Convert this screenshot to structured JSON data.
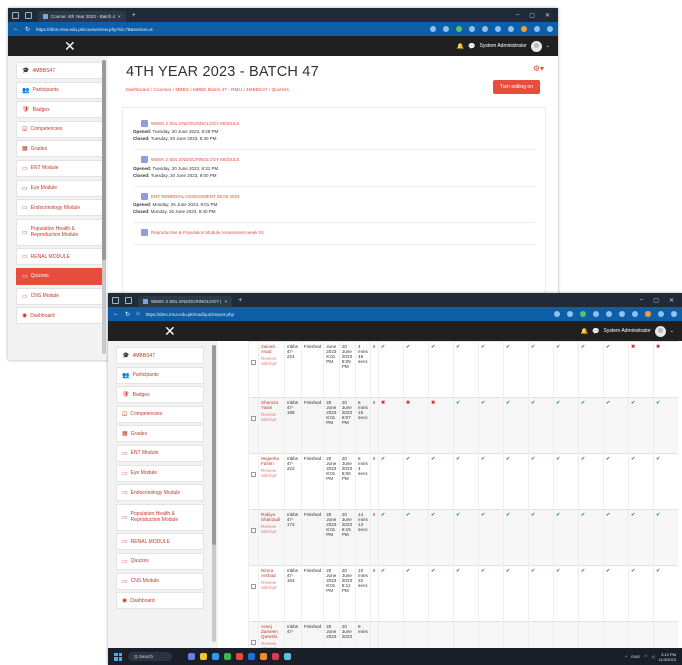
{
  "win1": {
    "tab_title": "Course: 4th Year 2023 - Batch 4",
    "url": "https://dms.rmur.edu.pk/course/view.php?id=75&section=6",
    "user": "System Administrator",
    "page_title": "4TH YEAR 2023 - BATCH 47",
    "breadcrumb": "Dashboard  /  Courses  /  MBBS  /  MBBS Batch 47 - RMU  /  4MBBS47  /  Quizzes",
    "edit_button": "Turn editing on",
    "nav": [
      {
        "label": "4MBBS47",
        "icon": "graduation-cap-icon",
        "glyph": "🎓"
      },
      {
        "label": "Participants",
        "icon": "users-icon",
        "glyph": "👥"
      },
      {
        "label": "Badges",
        "icon": "shield-icon",
        "glyph": "🛡"
      },
      {
        "label": "Competencies",
        "icon": "check-square-icon",
        "glyph": "☑"
      },
      {
        "label": "Grades",
        "icon": "table-icon",
        "glyph": "▦"
      },
      {
        "label": "ENT Module",
        "icon": "folder-icon",
        "glyph": "▭"
      },
      {
        "label": "Eye Module",
        "icon": "folder-icon",
        "glyph": "▭"
      },
      {
        "label": "Endocrinology Module",
        "icon": "folder-icon",
        "glyph": "▭"
      },
      {
        "label": "Population Health & Reproduction Module",
        "icon": "folder-icon",
        "glyph": "▭"
      },
      {
        "label": "RENAL MODULE",
        "icon": "folder-icon",
        "glyph": "▭"
      },
      {
        "label": "Quizzes",
        "icon": "folder-icon",
        "glyph": "▭"
      },
      {
        "label": "CNS Module",
        "icon": "folder-icon",
        "glyph": "▭"
      },
      {
        "label": "Dashboard",
        "icon": "tachometer-icon",
        "glyph": "◉"
      }
    ],
    "quizzes": [
      {
        "title": "WEEK 2 SDL ENDOCRINOLOGY MODULE",
        "opened": "Tuesday, 20 June 2023, 8:28 PM",
        "closed": "Tuesday, 20 June 2023, 8:30 PM"
      },
      {
        "title": "WEEK 2 SDL ENDOCRINOLOGY MODULE",
        "opened": "Tuesday, 20 June 2023, 8:31 PM",
        "closed": "Tuesday, 20 June 2023, 9:00 PM"
      },
      {
        "title": "ENT REMEDIAL ASSESSMENT 26.06.2023",
        "opened": "Monday, 26 June 2023, 9:01 PM",
        "closed": "Monday, 26 June 2023, 9:40 PM"
      },
      {
        "title": "Reproductive & Population Module Assessment week 01",
        "opened": "",
        "closed": ""
      }
    ],
    "labels": {
      "opened": "Opened:",
      "closed": "Closed:"
    }
  },
  "win2": {
    "tab_title": "WEEK 2 SDL ENDOCRINOLOGY |",
    "url": "https://dms.rmur.edu.pk/mod/quiz/report.php",
    "user": "System Administrator",
    "nav": [
      {
        "label": "4MBBS47",
        "glyph": "🎓"
      },
      {
        "label": "Participants",
        "glyph": "👥"
      },
      {
        "label": "Badges",
        "glyph": "🛡"
      },
      {
        "label": "Competencies",
        "glyph": "☑"
      },
      {
        "label": "Grades",
        "glyph": "▦"
      },
      {
        "label": "ENT Module",
        "glyph": "▭"
      },
      {
        "label": "Eye Module",
        "glyph": "▭"
      },
      {
        "label": "Endocrinology Module",
        "glyph": "▭"
      },
      {
        "label": "Population Health & Reproduction Module",
        "glyph": "▭"
      },
      {
        "label": "RENAL MODULE",
        "glyph": "▭"
      },
      {
        "label": "Quizzes",
        "glyph": "▭"
      },
      {
        "label": "CNS Module",
        "glyph": "▭"
      },
      {
        "label": "Dashboard",
        "glyph": "◉"
      }
    ],
    "review_label": "Review attempt",
    "rows": [
      {
        "name": "Zainab Asad",
        "id": "mbbs 47-224",
        "state": "Finished",
        "started": "June 2023 8:01 PM",
        "completed": "20 June 2023 8:05 PM",
        "taken": "4 mins 46 secs",
        "grade": "8",
        "marks": [
          "ok",
          "ok",
          "ok",
          "ok",
          "ok",
          "ok",
          "ok",
          "ok",
          "ok",
          "ok",
          "bad",
          "bad"
        ]
      },
      {
        "name": "Sharoza Yasin",
        "id": "mbbs 47-198",
        "state": "Finished",
        "started": "20 June 2023 8:01 PM",
        "completed": "20 June 2023 8:07 PM",
        "taken": "6 mins 15 secs",
        "grade": "6",
        "marks": [
          "bad",
          "bad",
          "bad",
          "ok",
          "ok",
          "ok",
          "ok",
          "ok",
          "ok",
          "ok",
          "ok",
          "ok"
        ]
      },
      {
        "name": "Wajeeha Fahim",
        "id": "mbbs 47-222",
        "state": "Finished",
        "started": "20 June 2023 8:01 PM",
        "completed": "20 June 2023 8:06 PM",
        "taken": "5 mins 4 secs",
        "grade": "9",
        "marks": [
          "ok",
          "ok",
          "ok",
          "ok",
          "ok",
          "ok",
          "ok",
          "ok",
          "ok",
          "ok",
          "ok",
          "ok"
        ]
      },
      {
        "name": "Rabiya Shahzadi",
        "id": "mbbs 47-173",
        "state": "Finished",
        "started": "20 June 2023 8:01 PM",
        "completed": "20 June 2023 8:15 PM",
        "taken": "14 mins 13 secs",
        "grade": "8",
        "marks": [
          "ok",
          "ok",
          "ok",
          "ok",
          "ok",
          "ok",
          "ok",
          "ok",
          "ok",
          "ok",
          "ok",
          "ok"
        ]
      },
      {
        "name": "Nimra Arshad",
        "id": "mbbs 47-163",
        "state": "Finished",
        "started": "20 June 2023 8:01 PM",
        "completed": "20 June 2023 8:11 PM",
        "taken": "10 mins 32 secs",
        "grade": "8",
        "marks": [
          "ok",
          "ok",
          "ok",
          "ok",
          "ok",
          "ok",
          "ok",
          "ok",
          "ok",
          "ok",
          "ok",
          "ok"
        ]
      },
      {
        "name": "Areej Zameen Qureshi",
        "id": "mbbs 47-",
        "state": "Finished",
        "started": "20 June 2023",
        "completed": "20 June 2023",
        "taken": "9 mins",
        "grade": "",
        "marks": []
      }
    ],
    "taskbar": {
      "search": "Q Search",
      "lang": "ENG",
      "time": "3:12 PM",
      "date": "11/3/2023"
    }
  }
}
